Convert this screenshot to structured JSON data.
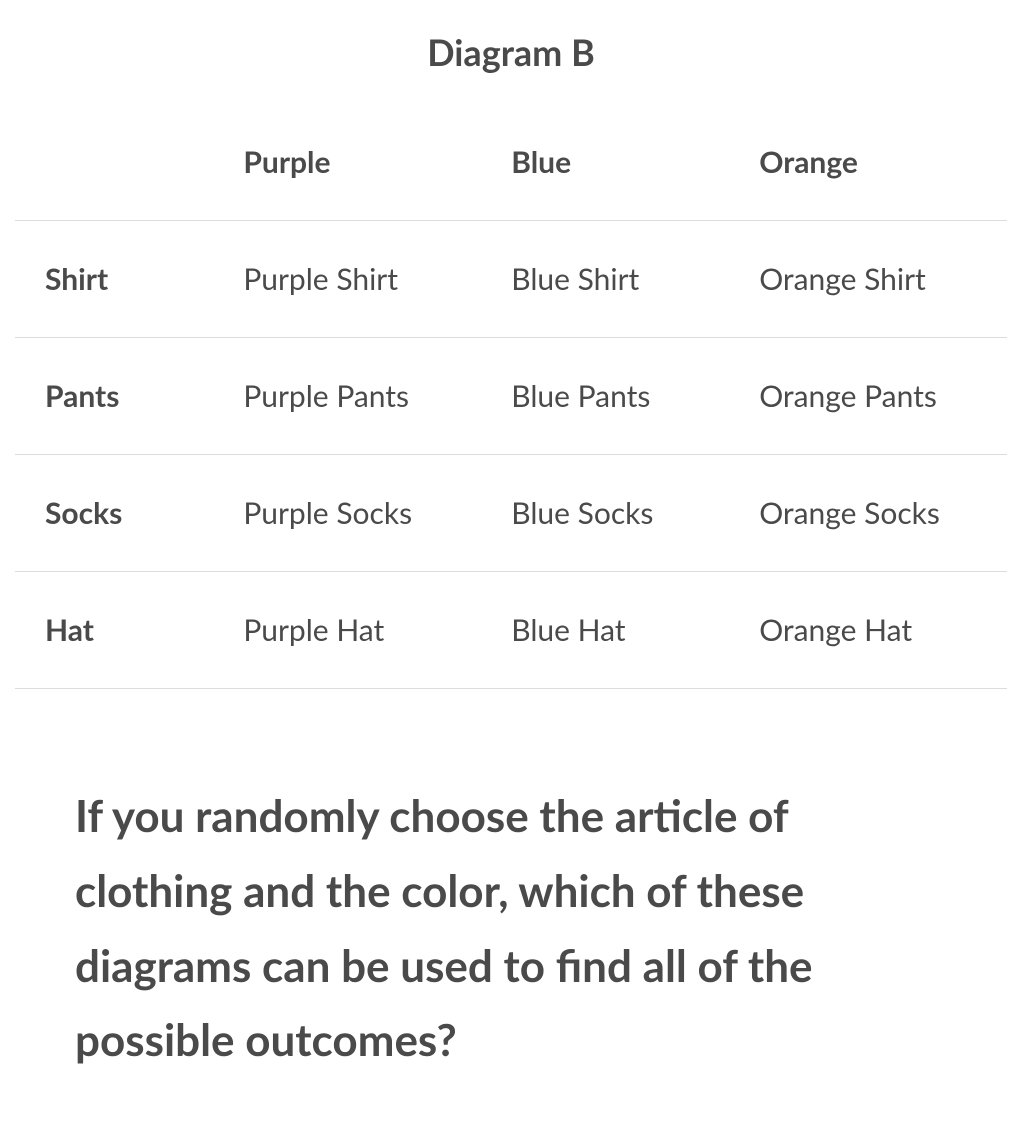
{
  "title": "Diagram B",
  "columns": [
    "Purple",
    "Blue",
    "Orange"
  ],
  "rows": [
    {
      "header": "Shirt",
      "cells": [
        "Purple Shirt",
        "Blue Shirt",
        "Orange Shirt"
      ]
    },
    {
      "header": "Pants",
      "cells": [
        "Purple Pants",
        "Blue Pants",
        "Orange Pants"
      ]
    },
    {
      "header": "Socks",
      "cells": [
        "Purple Socks",
        "Blue Socks",
        "Orange Socks"
      ]
    },
    {
      "header": "Hat",
      "cells": [
        "Purple Hat",
        "Blue Hat",
        "Orange Hat"
      ]
    }
  ],
  "question": "If you randomly choose the article of clothing and the color, which of these diagrams can be used to find all of the possible outcomes?"
}
